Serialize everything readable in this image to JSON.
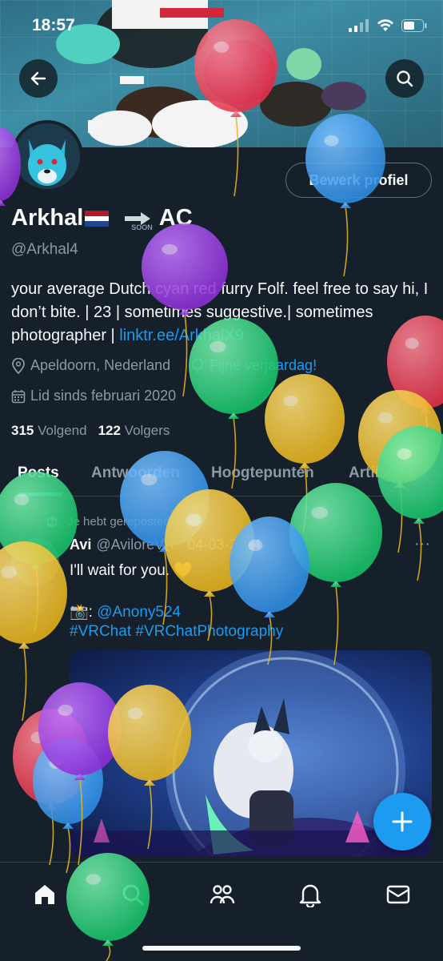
{
  "status_bar": {
    "time": "18:57"
  },
  "header": {
    "back_label": "back",
    "search_label": "search"
  },
  "profile": {
    "edit_button": "Bewerk profiel",
    "display_name_start": "Arkhal",
    "display_name_end": "AC",
    "soon_label": "SOON",
    "handle": "@Arkhal4",
    "bio_text": "your average Dutch cyan red furry Folf. feel free to say hi, I don’t bite. | 23 | sometimes suggestive.| sometimes photographer | ",
    "bio_link": "linktr.ee/ArkhalX9",
    "location": "Apeldoorn, Nederland",
    "birthday": "Fijne verjaardag!",
    "joined": "Lid sinds februari 2020",
    "following_count": "315",
    "following_label": "Volgend",
    "followers_count": "122",
    "followers_label": "Volgers"
  },
  "tabs": [
    {
      "label": "Posts",
      "active": true
    },
    {
      "label": "Antwoorden",
      "active": false
    },
    {
      "label": "Hoogtepunten",
      "active": false
    },
    {
      "label": "Artikelen",
      "active": false
    }
  ],
  "tweet": {
    "repost_label": "Je hebt gereposted",
    "author": "Avi",
    "meta": "@AviloreVR · 04-03-2024",
    "more": "···",
    "line1": "I'll wait for you. 💛",
    "line2_prefix": "📸: ",
    "line2_link": "@Anony524",
    "hashtags": "#VRChat #VRChatPhotography"
  },
  "colors": {
    "background": "#15202b",
    "accent": "#1d9bf0",
    "secondary_text": "#8b98a5",
    "balloon_red": "#e8334a",
    "balloon_blue": "#2f8fe6",
    "balloon_purple": "#8e2fd6",
    "balloon_green": "#17c46a",
    "balloon_yellow": "#e8b51c"
  },
  "icons": {
    "nav": [
      "home-icon",
      "search-icon",
      "communities-icon",
      "bell-icon",
      "mail-icon"
    ],
    "fab": "plus-icon"
  }
}
